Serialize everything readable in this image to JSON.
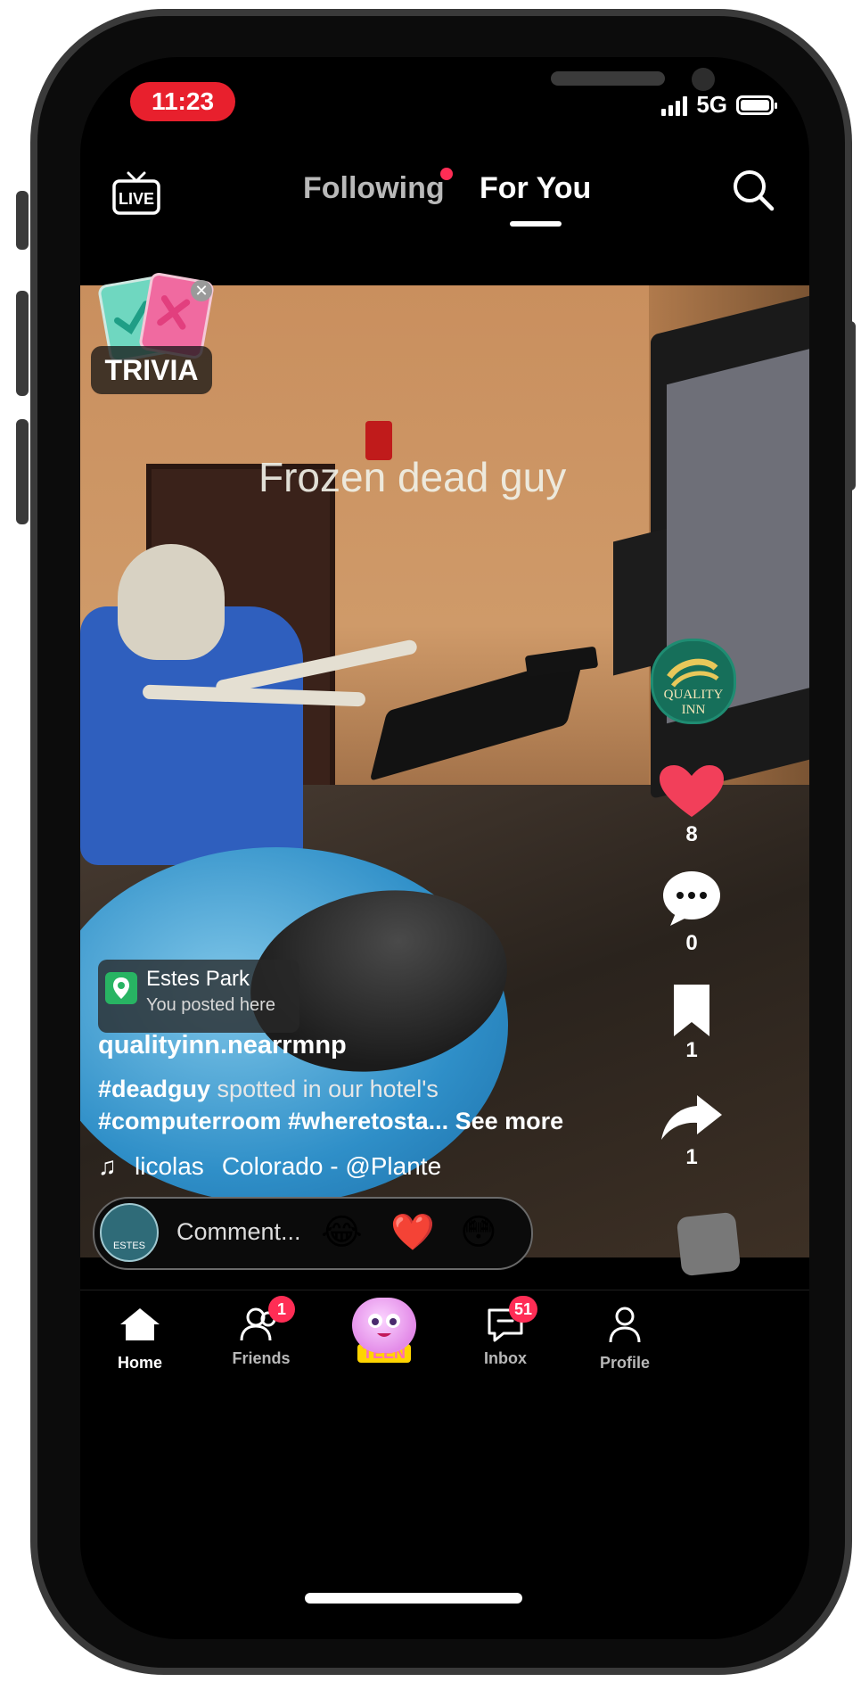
{
  "status_bar": {
    "time": "11:23",
    "network": "5G"
  },
  "top_nav": {
    "live_label": "LIVE",
    "following": "Following",
    "for_you": "For You"
  },
  "video": {
    "overlay_text": "Frozen dead guy",
    "trivia_label": "TRIVIA",
    "brand_text": "QUALITY INN"
  },
  "actions": {
    "likes": "8",
    "comments": "0",
    "saves": "1",
    "shares": "1"
  },
  "location": {
    "title": "Estes Park",
    "subtitle": "You posted here"
  },
  "caption": {
    "username": "qualityinn.nearrmnp",
    "hashtag1": "#deadguy",
    "text1": " spotted in our hotel's",
    "line2": "#computerroom #wheretosta... See more"
  },
  "music": {
    "artist": "licolas",
    "track": "Colorado - @Plante"
  },
  "comment_bar": {
    "placeholder": "Comment...",
    "avatar_text": "ESTES"
  },
  "bottom_nav": {
    "home": "Home",
    "friends": "Friends",
    "friends_badge": "1",
    "create_label": "TEEN",
    "inbox": "Inbox",
    "inbox_badge": "51",
    "profile": "Profile"
  },
  "colors": {
    "accent": "#ff2d55",
    "time_pill": "#e8202d",
    "like": "#f23f5a"
  }
}
